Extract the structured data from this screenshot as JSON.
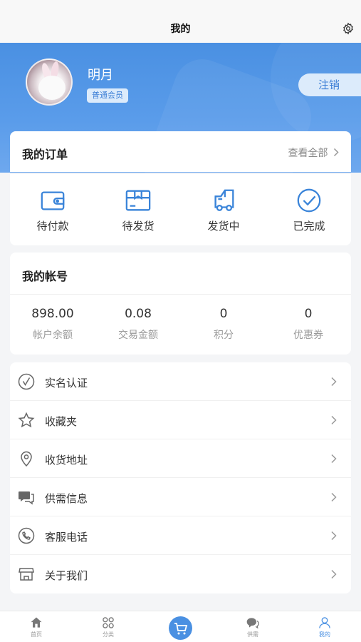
{
  "header": {
    "title": "我的"
  },
  "profile": {
    "name": "明月",
    "membership": "普通会员",
    "logout_label": "注销"
  },
  "orders": {
    "title": "我的订单",
    "view_all": "查看全部",
    "items": [
      {
        "label": "待付款",
        "icon": "wallet-icon"
      },
      {
        "label": "待发货",
        "icon": "package-icon"
      },
      {
        "label": "发货中",
        "icon": "truck-icon"
      },
      {
        "label": "已完成",
        "icon": "check-circle-icon"
      }
    ]
  },
  "account": {
    "title": "我的帐号",
    "stats": [
      {
        "value": "898.00",
        "label": "帐户余额"
      },
      {
        "value": "0.08",
        "label": "交易金额"
      },
      {
        "value": "0",
        "label": "积分"
      },
      {
        "value": "0",
        "label": "优惠券"
      }
    ]
  },
  "menu": [
    {
      "label": "实名认证",
      "icon": "verify-icon"
    },
    {
      "label": "收藏夹",
      "icon": "star-icon"
    },
    {
      "label": "收货地址",
      "icon": "location-icon"
    },
    {
      "label": "供需信息",
      "icon": "chat-icon"
    },
    {
      "label": "客服电话",
      "icon": "phone-icon"
    },
    {
      "label": "关于我们",
      "icon": "store-icon"
    }
  ],
  "tabbar": [
    {
      "label": "首页",
      "icon": "home-icon"
    },
    {
      "label": "分类",
      "icon": "category-icon"
    },
    {
      "label": "",
      "icon": "cart-icon"
    },
    {
      "label": "供需",
      "icon": "chat-icon"
    },
    {
      "label": "我的",
      "icon": "user-icon",
      "active": true
    }
  ],
  "colors": {
    "accent": "#4a90e2",
    "badge_bg": "#dcebfb",
    "badge_text": "#3d7fd6"
  }
}
